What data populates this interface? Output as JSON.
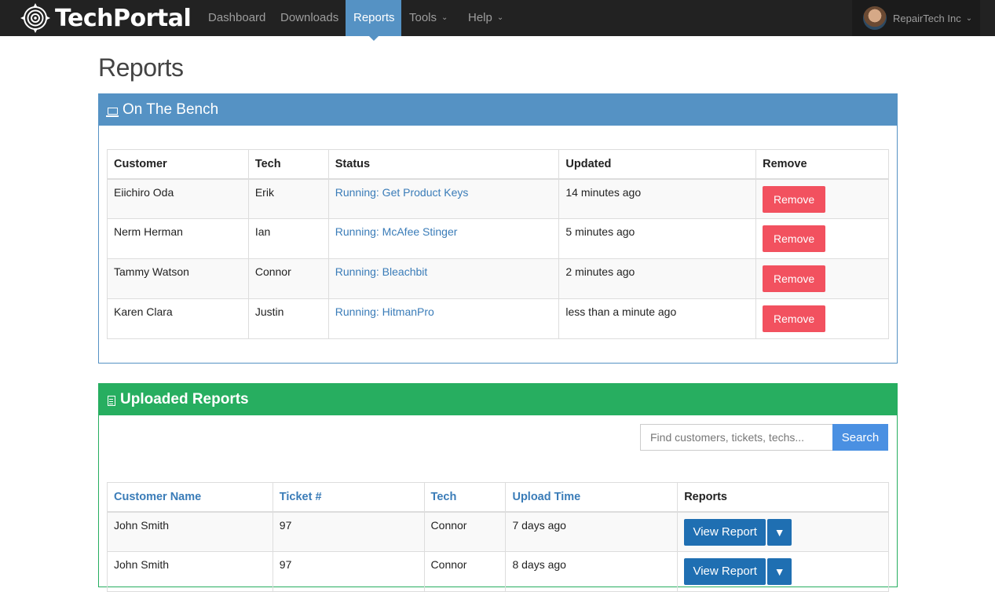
{
  "navbar": {
    "brand": "TechPortal",
    "brand_icon": "target-logo-icon",
    "items": [
      {
        "label": "Dashboard",
        "has_caret": false
      },
      {
        "label": "Downloads",
        "has_caret": false
      },
      {
        "label": "Reports",
        "has_caret": false,
        "active": true
      },
      {
        "label": "Tools",
        "has_caret": true
      },
      {
        "label": "Help",
        "has_caret": true
      }
    ],
    "user": {
      "name": "RepairTech Inc",
      "avatar_icon": "user-avatar"
    }
  },
  "page": {
    "title": "Reports"
  },
  "bench": {
    "title": "On The Bench",
    "icon": "laptop-icon",
    "columns": [
      "Customer",
      "Tech",
      "Status",
      "Updated",
      "Remove"
    ],
    "rows": [
      {
        "customer": "Eiichiro Oda",
        "tech": "Erik",
        "status": "Running: Get Product Keys",
        "updated": "14 minutes ago",
        "action": "Remove"
      },
      {
        "customer": "Nerm Herman",
        "tech": "Ian",
        "status": "Running: McAfee Stinger",
        "updated": "5 minutes ago",
        "action": "Remove"
      },
      {
        "customer": "Tammy Watson",
        "tech": "Connor",
        "status": "Running: Bleachbit",
        "updated": "2 minutes ago",
        "action": "Remove"
      },
      {
        "customer": "Karen Clara",
        "tech": "Justin",
        "status": "Running: HitmanPro",
        "updated": "less than a minute ago",
        "action": "Remove"
      }
    ]
  },
  "uploads": {
    "title": "Uploaded Reports",
    "icon": "document-icon",
    "search": {
      "placeholder": "Find customers, tickets, techs...",
      "button": "Search"
    },
    "columns": [
      "Customer Name",
      "Ticket #",
      "Tech",
      "Upload Time",
      "Reports"
    ],
    "rows": [
      {
        "customer": "John Smith",
        "ticket": "97",
        "tech": "Connor",
        "uploaded": "7 days ago",
        "action": "View Report",
        "dropdown": "▼"
      },
      {
        "customer": "John Smith",
        "ticket": "97",
        "tech": "Connor",
        "uploaded": "8 days ago",
        "action": "View Report",
        "dropdown": "▼"
      }
    ]
  },
  "colors": {
    "navbar_bg": "#222222",
    "nav_active": "#5592c4",
    "bench_header": "#5592c4",
    "uploads_header": "#27ae60",
    "remove_button": "#f2515f",
    "view_button": "#1f6fb2",
    "search_button": "#4a90e2",
    "link": "#3a7cb8"
  }
}
